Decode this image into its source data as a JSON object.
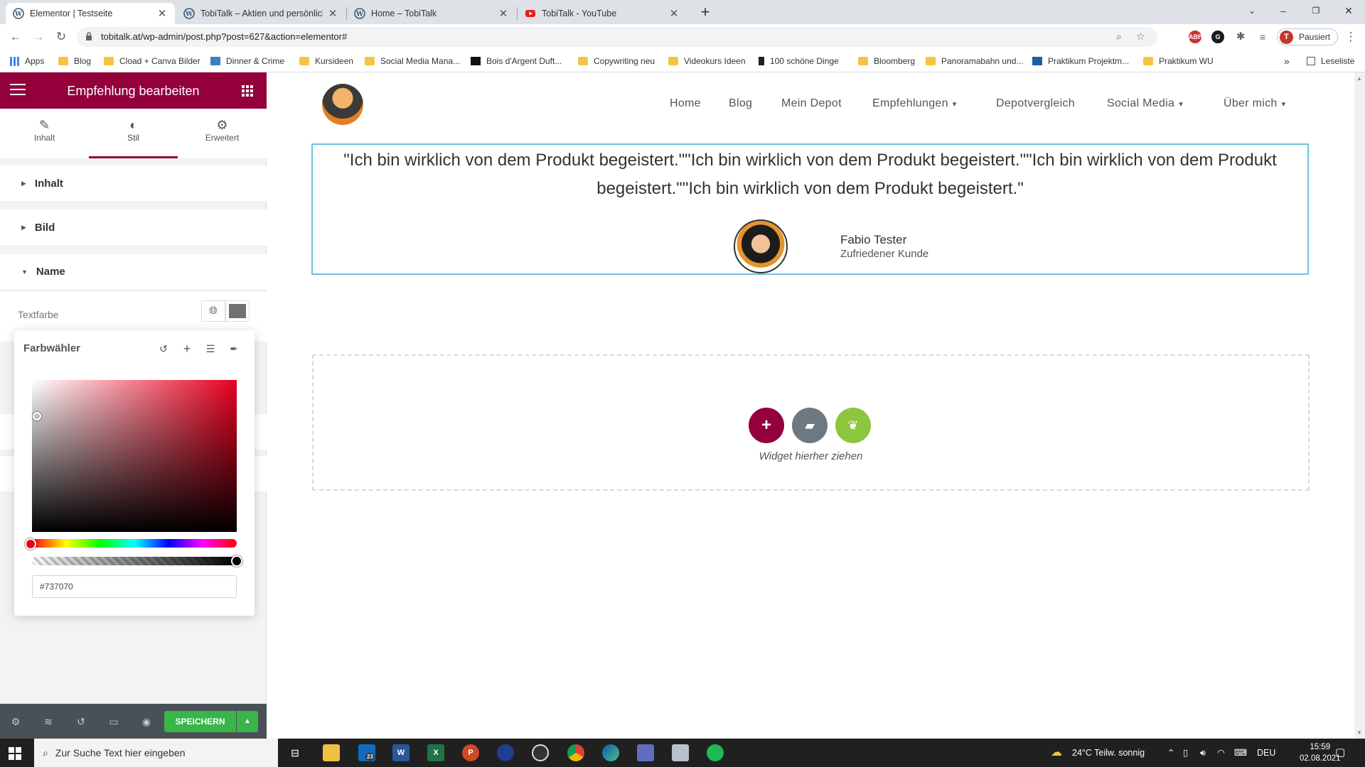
{
  "browser": {
    "tabs": [
      {
        "title": "Elementor | Testseite",
        "active": true,
        "icon": "wordpress-icon"
      },
      {
        "title": "TobiTalk – Aktien und persönliche",
        "active": false,
        "icon": "wordpress-icon"
      },
      {
        "title": "Home – TobiTalk",
        "active": false,
        "icon": "wordpress-icon"
      },
      {
        "title": "TobiTalk - YouTube",
        "active": false,
        "icon": "youtube-icon"
      }
    ],
    "url": "tobitalk.at/wp-admin/post.php?post=627&action=elementor#",
    "profile_status": "Pausiert",
    "profile_initial": "T",
    "bookmarks": [
      "Apps",
      "Blog",
      "Cload + Canva Bilder",
      "Dinner & Crime",
      "Kursideen",
      "Social Media Mana...",
      "Bois d'Argent Duft...",
      "Copywriting neu",
      "Videokurs Ideen",
      "100 schöne Dinge",
      "Bloomberg",
      "Panoramabahn und...",
      "Praktikum Projektm...",
      "Praktikum WU"
    ],
    "bookmarks_more": "»",
    "reading_list": "Leseliste"
  },
  "panel": {
    "title": "Empfehlung bearbeiten",
    "tabs": [
      {
        "label": "Inhalt",
        "icon": "pencil-icon"
      },
      {
        "label": "Stil",
        "icon": "contrast-icon"
      },
      {
        "label": "Erweitert",
        "icon": "gear-icon"
      }
    ],
    "active_tab": "Stil",
    "sections": [
      "Inhalt",
      "Bild",
      "Name"
    ],
    "expanded_section": "Name",
    "textfarbe_label": "Textfarbe",
    "picker": {
      "title": "Farbwähler",
      "hex_value": "#737070",
      "hue_color": "#e8001e"
    },
    "save_label": "SPEICHERN",
    "accent_color": "#93003c",
    "save_color": "#39b54a"
  },
  "page": {
    "nav": [
      {
        "label": "Home",
        "has_dropdown": false
      },
      {
        "label": "Blog",
        "has_dropdown": false
      },
      {
        "label": "Mein Depot",
        "has_dropdown": false
      },
      {
        "label": "Empfehlungen",
        "has_dropdown": true
      },
      {
        "label": "Depotvergleich",
        "has_dropdown": false
      },
      {
        "label": "Social Media",
        "has_dropdown": true
      },
      {
        "label": "Über mich",
        "has_dropdown": true
      }
    ],
    "testimonial": {
      "quote": "\"Ich bin wirklich von dem Produkt begeistert.\"\"Ich bin wirklich von dem Produkt begeistert.\"\"Ich bin wirklich von dem Produkt begeistert.\"\"Ich bin wirklich von dem Produkt begeistert.\"",
      "name": "Fabio Tester",
      "title": "Zufriedener Kunde"
    },
    "dropzone_text": "Widget hierher ziehen"
  },
  "taskbar": {
    "search_placeholder": "Zur Suche Text hier eingeben",
    "weather": "24°C  Teilw. sonnig",
    "language": "DEU",
    "time": "15:59",
    "date": "02.08.2021",
    "mail_badge": "23"
  }
}
